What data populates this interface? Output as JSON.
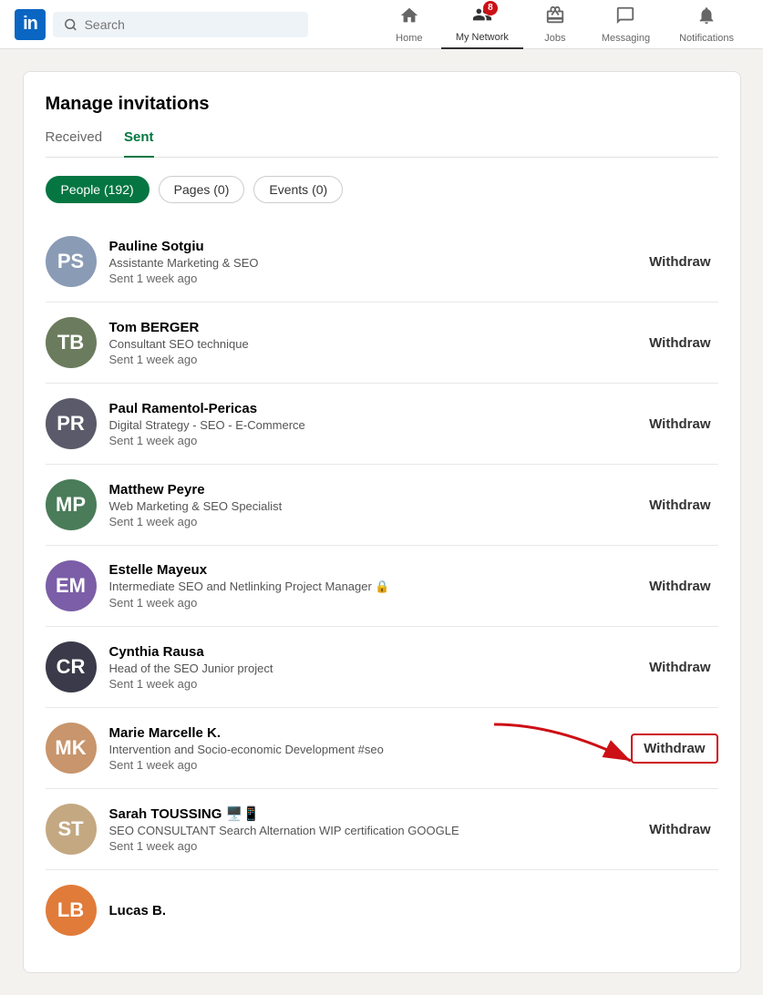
{
  "navbar": {
    "logo_text": "in",
    "search_placeholder": "Search",
    "nav_items": [
      {
        "id": "home",
        "label": "Home",
        "icon": "🏠",
        "active": false,
        "badge": null
      },
      {
        "id": "my-network",
        "label": "My Network",
        "icon": "👥",
        "active": true,
        "badge": "8"
      },
      {
        "id": "jobs",
        "label": "Jobs",
        "icon": "💼",
        "active": false,
        "badge": null
      },
      {
        "id": "messaging",
        "label": "Messaging",
        "icon": "💬",
        "active": false,
        "badge": null
      },
      {
        "id": "notifications",
        "label": "Notifications",
        "icon": "🔔",
        "active": false,
        "badge": null
      }
    ]
  },
  "page": {
    "title": "Manage invitations",
    "tabs": [
      {
        "id": "received",
        "label": "Received",
        "active": false
      },
      {
        "id": "sent",
        "label": "Sent",
        "active": true
      }
    ],
    "filters": [
      {
        "id": "people",
        "label": "People (192)",
        "active": true
      },
      {
        "id": "pages",
        "label": "Pages (0)",
        "active": false
      },
      {
        "id": "events",
        "label": "Events (0)",
        "active": false
      }
    ],
    "invitations": [
      {
        "id": 1,
        "name": "Pauline Sotgiu",
        "title": "Assistante Marketing & SEO",
        "sent": "Sent 1 week ago",
        "initials": "PS",
        "bg": "#8a9bb5",
        "highlighted": false
      },
      {
        "id": 2,
        "name": "Tom BERGER",
        "title": "Consultant SEO technique",
        "sent": "Sent 1 week ago",
        "initials": "TB",
        "bg": "#6b7c5e",
        "highlighted": false
      },
      {
        "id": 3,
        "name": "Paul Ramentol-Pericas",
        "title": "Digital Strategy - SEO - E-Commerce",
        "sent": "Sent 1 week ago",
        "initials": "PR",
        "bg": "#5a5a6a",
        "highlighted": false
      },
      {
        "id": 4,
        "name": "Matthew Peyre",
        "title": "Web Marketing & SEO Specialist",
        "sent": "Sent 1 week ago",
        "initials": "MP",
        "bg": "#4a7c59",
        "highlighted": false
      },
      {
        "id": 5,
        "name": "Estelle Mayeux",
        "title": "Intermediate SEO and Netlinking Project Manager 🔒",
        "sent": "Sent 1 week ago",
        "initials": "EM",
        "bg": "#7b5ea7",
        "highlighted": false
      },
      {
        "id": 6,
        "name": "Cynthia Rausa",
        "title": "Head of the SEO Junior project",
        "sent": "Sent 1 week ago",
        "initials": "CR",
        "bg": "#3a3a4a",
        "highlighted": false
      },
      {
        "id": 7,
        "name": "Marie Marcelle K.",
        "title": "Intervention and Socio-economic Development #seo",
        "sent": "Sent 1 week ago",
        "initials": "MK",
        "bg": "#c8956c",
        "highlighted": true
      },
      {
        "id": 8,
        "name": "Sarah TOUSSING 🖥️📱",
        "title": "SEO CONSULTANT Search Alternation WIP certification GOOGLE",
        "sent": "Sent 1 week ago",
        "initials": "ST",
        "bg": "#c4a882",
        "highlighted": false
      },
      {
        "id": 9,
        "name": "Lucas B.",
        "title": "",
        "sent": "",
        "initials": "LB",
        "bg": "#e07b3a",
        "highlighted": false,
        "partial": true
      }
    ],
    "withdraw_label": "Withdraw"
  }
}
